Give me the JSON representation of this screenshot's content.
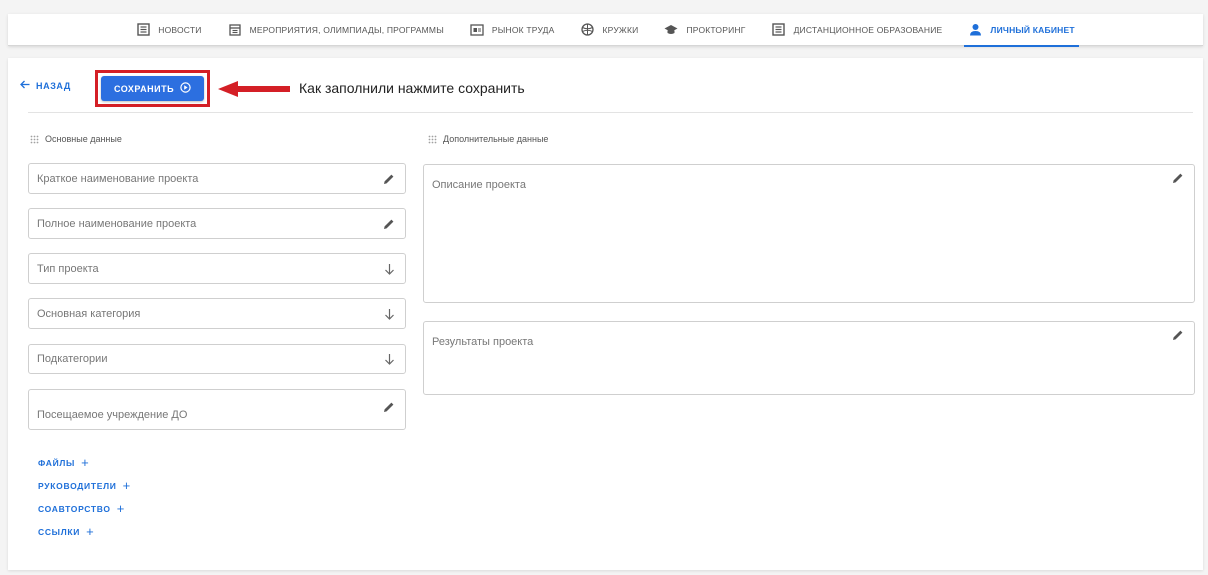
{
  "nav": {
    "items": [
      {
        "label": "НОВОСТИ",
        "icon": "news-icon",
        "active": false
      },
      {
        "label": "МЕРОПРИЯТИЯ, ОЛИМПИАДЫ, ПРОГРАММЫ",
        "icon": "calendar-icon",
        "active": false
      },
      {
        "label": "РЫНОК ТРУДА",
        "icon": "card-icon",
        "active": false
      },
      {
        "label": "КРУЖКИ",
        "icon": "ball-icon",
        "active": false
      },
      {
        "label": "ПРОКТОРИНГ",
        "icon": "graduation-cap-icon",
        "active": false
      },
      {
        "label": "ДИСТАНЦИОННОЕ ОБРАЗОВАНИЕ",
        "icon": "news-icon",
        "active": false
      },
      {
        "label": "ЛИЧНЫЙ КАБИНЕТ",
        "icon": "person-icon",
        "active": true
      }
    ]
  },
  "toolbar": {
    "back_label": "НАЗАД",
    "save_label": "СОХРАНИТЬ",
    "hint": "Как заполнили нажмите сохранить"
  },
  "left": {
    "title": "Основные данные",
    "fields": [
      {
        "label": "Краткое наименование проекта",
        "icon": "pencil-icon"
      },
      {
        "label": "Полное наименование проекта",
        "icon": "pencil-icon"
      },
      {
        "label": "Тип проекта",
        "icon": "arrow-down-icon"
      },
      {
        "label": "Основная категория",
        "icon": "arrow-down-icon"
      },
      {
        "label": "Подкатегории",
        "icon": "arrow-down-icon"
      },
      {
        "label": "Посещаемое учреждение ДО",
        "icon": "pencil-icon"
      }
    ],
    "links": [
      "ФАЙЛЫ",
      "РУКОВОДИТЕЛИ",
      "СОАВТОРСТВО",
      "ССЫЛКИ"
    ],
    "link_plus": "+"
  },
  "right": {
    "title": "Дополнительные данные",
    "areas": [
      {
        "label": "Описание проекта",
        "icon": "pencil-icon"
      },
      {
        "label": "Результаты проекта",
        "icon": "pencil-icon"
      }
    ]
  },
  "colors": {
    "accent": "#1e6fd9",
    "highlight": "#d41f26"
  }
}
